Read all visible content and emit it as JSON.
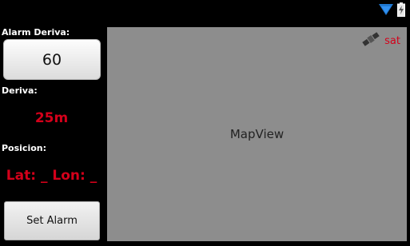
{
  "status_bar": {
    "wifi_icon": "wifi-icon",
    "battery_icon": "battery-charging-icon"
  },
  "sidebar": {
    "alarm_label": "Alarm Deriva:",
    "alarm_value": "60",
    "deriva_label": "Deriva:",
    "deriva_value": "25m",
    "posicion_label": "Posicion:",
    "posicion_value": "Lat: _ Lon: _",
    "set_alarm_button": "Set Alarm"
  },
  "map": {
    "label": "MapView",
    "sat_label": "sat",
    "sat_icon": "satellite-icon"
  },
  "colors": {
    "accent_red": "#d4001a",
    "map_bg": "#8d8d8d",
    "wifi_blue": "#1f78d1"
  }
}
